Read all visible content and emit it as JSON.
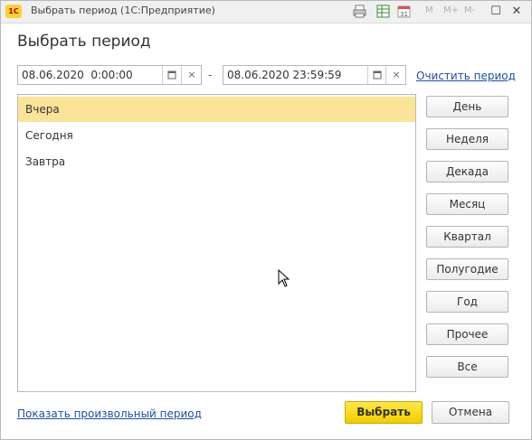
{
  "window": {
    "app_logo": "1С",
    "title": "Выбрать период  (1С:Предприятие)",
    "toolbar": {
      "m_label": "M",
      "m_plus_label": "M+",
      "m_minus_label": "M-",
      "minimize": "—",
      "maximize": "☐",
      "close": "✕"
    }
  },
  "dialog": {
    "heading": "Выбрать период",
    "start_date": "08.06.2020  0:00:00",
    "end_date": "08.06.2020 23:59:59",
    "range_separator": "-",
    "clear_icon": "×",
    "clear_period_link": "Очистить период",
    "quick_periods": [
      "Вчера",
      "Сегодня",
      "Завтра"
    ],
    "selected_index": 0,
    "period_buttons": [
      "День",
      "Неделя",
      "Декада",
      "Месяц",
      "Квартал",
      "Полугодие",
      "Год",
      "Прочее",
      "Все"
    ],
    "custom_period_link": "Показать произвольный период",
    "select_button": "Выбрать",
    "cancel_button": "Отмена"
  },
  "colors": {
    "selection": "#fbe49a",
    "primary_button": "#f3cc00",
    "link": "#1e4f9c"
  }
}
